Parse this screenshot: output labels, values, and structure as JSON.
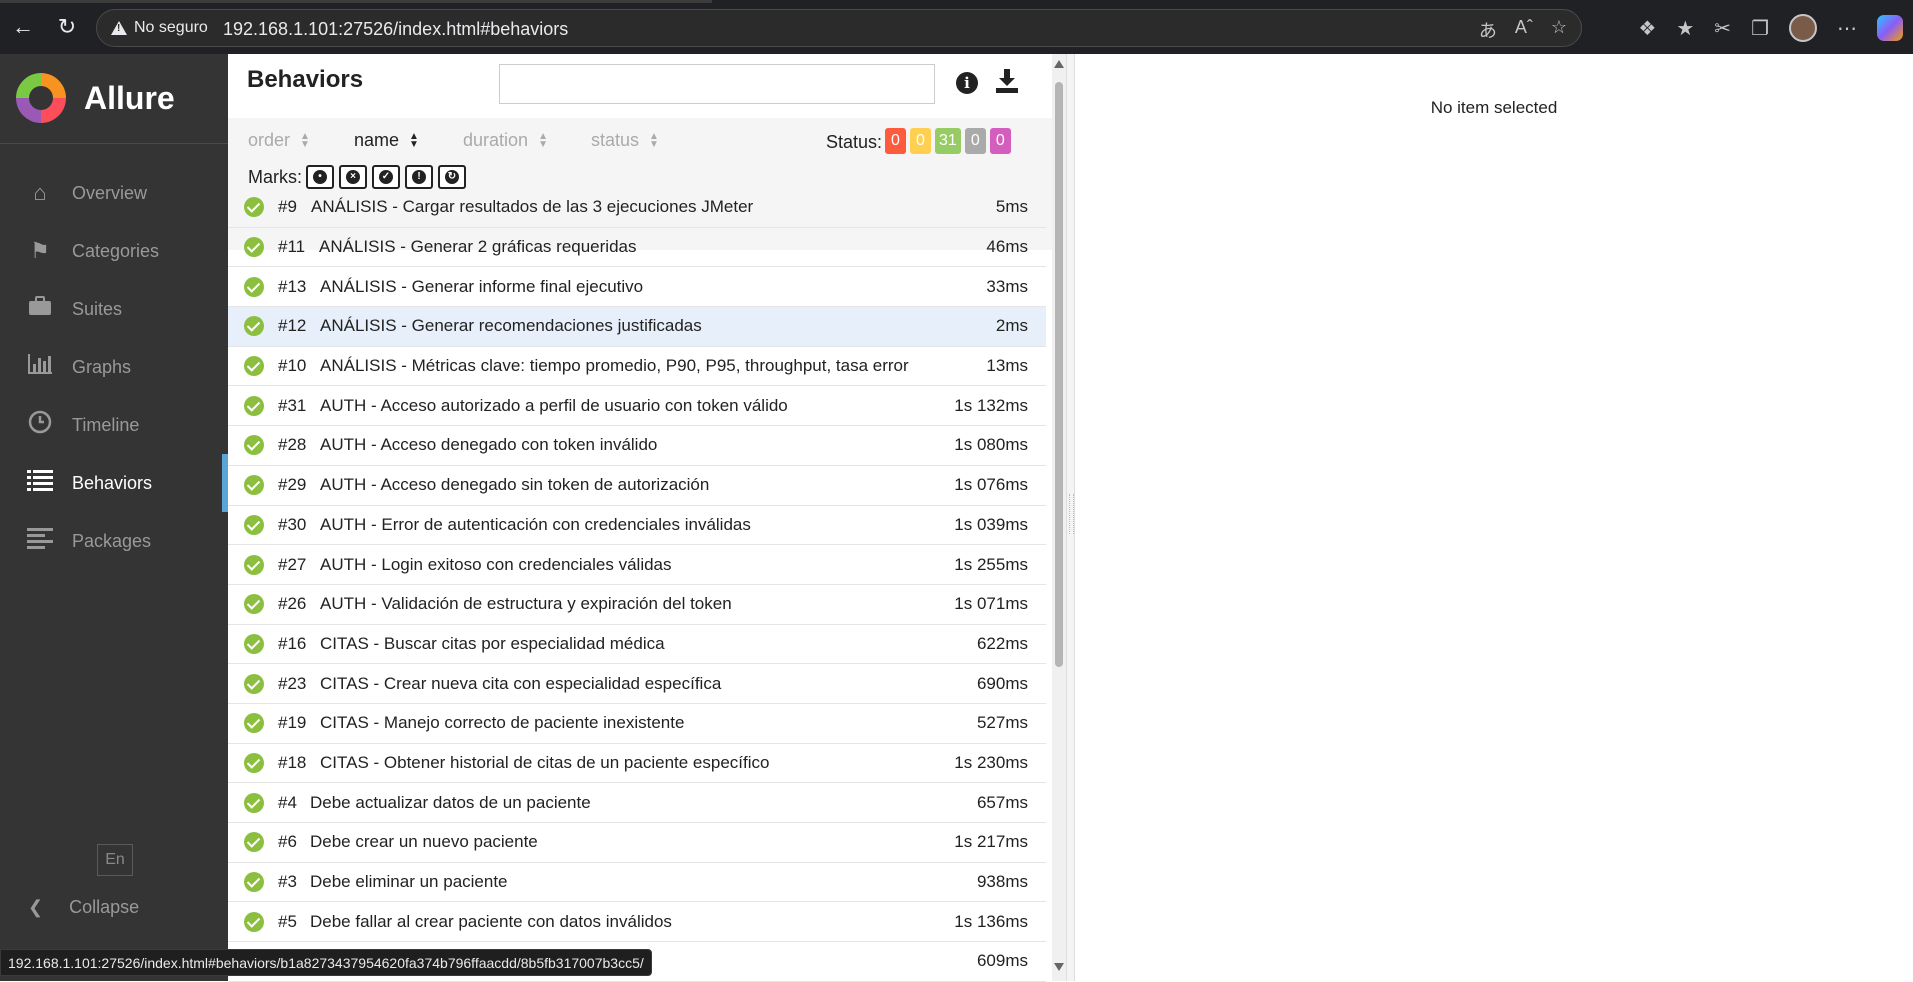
{
  "browser": {
    "insecure_label": "No seguro",
    "url": "192.168.1.101:27526/index.html#behaviors"
  },
  "sidebar": {
    "brand": "Allure",
    "items": [
      {
        "label": "Overview",
        "icon": "home-icon"
      },
      {
        "label": "Categories",
        "icon": "flag-icon"
      },
      {
        "label": "Suites",
        "icon": "briefcase-icon"
      },
      {
        "label": "Graphs",
        "icon": "bar-chart-icon"
      },
      {
        "label": "Timeline",
        "icon": "clock-icon"
      },
      {
        "label": "Behaviors",
        "icon": "list-icon",
        "active": true
      },
      {
        "label": "Packages",
        "icon": "align-left-icon"
      }
    ],
    "language": "En",
    "collapse_label": "Collapse"
  },
  "list": {
    "title": "Behaviors",
    "search_value": "",
    "sorts": [
      {
        "label": "order",
        "active": false
      },
      {
        "label": "name",
        "active": true
      },
      {
        "label": "duration",
        "active": false
      },
      {
        "label": "status",
        "active": false
      }
    ],
    "status_label": "Status:",
    "status_counts": [
      {
        "value": "0",
        "color": "#fd5a3e"
      },
      {
        "value": "0",
        "color": "#ffd050"
      },
      {
        "value": "31",
        "color": "#97cc64"
      },
      {
        "value": "0",
        "color": "#aaaaaa"
      },
      {
        "value": "0",
        "color": "#d35ebe"
      }
    ],
    "marks_label": "Marks:",
    "rows": [
      {
        "id": "#9",
        "name": "ANÁLISIS - Cargar resultados de las 3 ejecuciones JMeter",
        "duration": "5ms"
      },
      {
        "id": "#11",
        "name": "ANÁLISIS - Generar 2 gráficas requeridas",
        "duration": "46ms"
      },
      {
        "id": "#13",
        "name": "ANÁLISIS - Generar informe final ejecutivo",
        "duration": "33ms"
      },
      {
        "id": "#12",
        "name": "ANÁLISIS - Generar recomendaciones justificadas",
        "duration": "2ms",
        "selected": true
      },
      {
        "id": "#10",
        "name": "ANÁLISIS - Métricas clave: tiempo promedio, P90, P95, throughput, tasa error",
        "duration": "13ms"
      },
      {
        "id": "#31",
        "name": "AUTH - Acceso autorizado a perfil de usuario con token válido",
        "duration": "1s 132ms"
      },
      {
        "id": "#28",
        "name": "AUTH - Acceso denegado con token inválido",
        "duration": "1s 080ms"
      },
      {
        "id": "#29",
        "name": "AUTH - Acceso denegado sin token de autorización",
        "duration": "1s 076ms"
      },
      {
        "id": "#30",
        "name": "AUTH - Error de autenticación con credenciales inválidas",
        "duration": "1s 039ms"
      },
      {
        "id": "#27",
        "name": "AUTH - Login exitoso con credenciales válidas",
        "duration": "1s 255ms"
      },
      {
        "id": "#26",
        "name": "AUTH - Validación de estructura y expiración del token",
        "duration": "1s 071ms"
      },
      {
        "id": "#16",
        "name": "CITAS - Buscar citas por especialidad médica",
        "duration": "622ms"
      },
      {
        "id": "#23",
        "name": "CITAS - Crear nueva cita con especialidad específica",
        "duration": "690ms"
      },
      {
        "id": "#19",
        "name": "CITAS - Manejo correcto de paciente inexistente",
        "duration": "527ms"
      },
      {
        "id": "#18",
        "name": "CITAS - Obtener historial de citas de un paciente específico",
        "duration": "1s 230ms"
      },
      {
        "id": "#4",
        "name": "Debe actualizar datos de un paciente",
        "duration": "657ms"
      },
      {
        "id": "#6",
        "name": "Debe crear un nuevo paciente",
        "duration": "1s 217ms"
      },
      {
        "id": "#3",
        "name": "Debe eliminar un paciente",
        "duration": "938ms"
      },
      {
        "id": "#5",
        "name": "Debe fallar al crear paciente con datos inválidos",
        "duration": "1s 136ms"
      },
      {
        "id": "",
        "name": "",
        "duration": "609ms"
      }
    ]
  },
  "detail": {
    "empty_text": "No item selected"
  },
  "status_bar": {
    "link": "192.168.1.101:27526/index.html#behaviors/b1a8273437954620fa374b796ffaacdd/8b5fb317007b3cc5/"
  }
}
